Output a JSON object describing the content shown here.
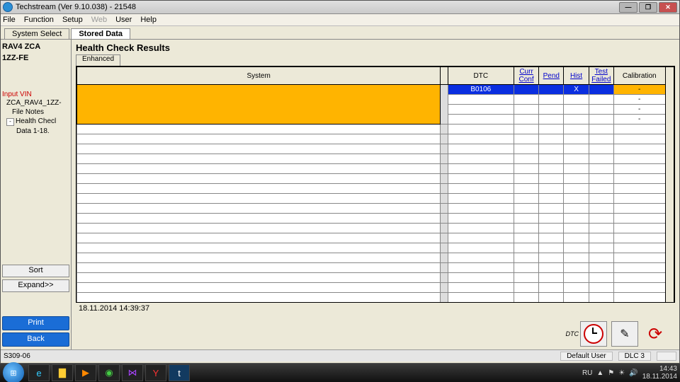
{
  "window": {
    "title": "Techstream (Ver 9.10.038) - 21548"
  },
  "menu": {
    "file": "File",
    "function": "Function",
    "setup": "Setup",
    "web": "Web",
    "user": "User",
    "help": "Help"
  },
  "tabs": {
    "system_select": "System Select",
    "stored_data": "Stored Data"
  },
  "vehicle": {
    "line1": "RAV4 ZCA",
    "line2": "1ZZ-FE"
  },
  "tree": {
    "input_vin": "Input VIN",
    "n1": "ZCA_RAV4_1ZZ-",
    "n2": "File Notes",
    "n3": "Health Checl",
    "n4": "Data 1-18."
  },
  "side_btns": {
    "sort": "Sort",
    "expand": "Expand>>",
    "print": "Print",
    "back": "Back"
  },
  "page": {
    "title": "Health Check Results",
    "subtab": "Enhanced",
    "timestamp": "18.11.2014 14:39:37"
  },
  "grid": {
    "hdr": {
      "system": "System",
      "dtc": "DTC",
      "curr": "Curr Conf",
      "pend": "Pend",
      "hist": "Hist",
      "test": "Test Failed",
      "cal": "Calibration"
    },
    "row1": {
      "dtc": "B0106",
      "hist": "X",
      "cal": "-"
    },
    "dash": "-"
  },
  "status": {
    "left": "S309-06",
    "user": "Default User",
    "dlc": "DLC 3"
  },
  "tray": {
    "lang": "RU",
    "time": "14:43",
    "date": "18.11.2014"
  },
  "dtc_label": "DTC"
}
